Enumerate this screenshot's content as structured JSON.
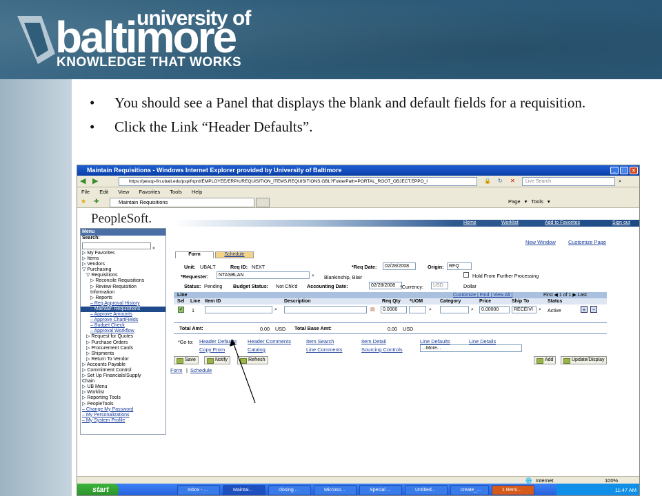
{
  "banner": {
    "university_of": "university of",
    "baltimore": "baltimore",
    "tagline": "KNOWLEDGE THAT WORKS"
  },
  "bullets": [
    "You should see a Panel that displays the blank and default fields for a requisition.",
    "Click the Link “Header Defaults”."
  ],
  "browser": {
    "title": "Maintain Requisitions - Windows Internet Explorer provided by University of Baltimore",
    "url": "https://pesop-fin.ubalt.edu/psp/fnprd/EMPLOYEE/ERP/c/REQUISITION_ITEMS.REQUISITIONS.GBL?FolderPath=PORTAL_ROOT_OBJECT.EPPO_I",
    "search_placeholder": "Live Search",
    "menu": [
      "File",
      "Edit",
      "View",
      "Favorites",
      "Tools",
      "Help"
    ],
    "tab": "Maintain Requisitions",
    "toolbar_right": "Page ▾  Tools ▾"
  },
  "ps": {
    "logo": "PeopleSoft.",
    "nav": [
      "Home",
      "Worklist",
      "Add to Favorites",
      "Sign out"
    ],
    "menu_title": "Menu",
    "search_label": "Search:",
    "menu_items": [
      {
        "t": "▷ My Favorites",
        "c": ""
      },
      {
        "t": "▷ Items",
        "c": ""
      },
      {
        "t": "▷ Vendors",
        "c": ""
      },
      {
        "t": "▽ Purchasing",
        "c": ""
      },
      {
        "t": "▽ Requisitions",
        "c": "i1"
      },
      {
        "t": "▷ Reconcile Requisitions",
        "c": "i2"
      },
      {
        "t": "▷ Review Requisition",
        "c": "i2"
      },
      {
        "t": "   Information",
        "c": "i2"
      },
      {
        "t": "▷ Reports",
        "c": "i2"
      },
      {
        "t": "– Req Approval History",
        "c": "i2 lnk"
      },
      {
        "t": "– Maintain Requisitions",
        "c": "i2 sel"
      },
      {
        "t": "– Approve Amounts",
        "c": "i2 lnk"
      },
      {
        "t": "– Approve ChartFields",
        "c": "i2 lnk"
      },
      {
        "t": "– Budget Check",
        "c": "i2 lnk"
      },
      {
        "t": "– Approval Workflow",
        "c": "i2 lnk"
      },
      {
        "t": "▷ Request for Quotes",
        "c": "i1"
      },
      {
        "t": "▷ Purchase Orders",
        "c": "i1"
      },
      {
        "t": "▷ Procurement Cards",
        "c": "i1"
      },
      {
        "t": "▷ Shipments",
        "c": "i1"
      },
      {
        "t": "▷ Return To Vendor",
        "c": "i1"
      },
      {
        "t": "▷ Accounts Payable",
        "c": ""
      },
      {
        "t": "▷ Commitment Control",
        "c": ""
      },
      {
        "t": "▷ Set Up Financials/Supply",
        "c": ""
      },
      {
        "t": "   Chain",
        "c": ""
      },
      {
        "t": "▷ UB Menu",
        "c": ""
      },
      {
        "t": "▷ Worklist",
        "c": ""
      },
      {
        "t": "▷ Reporting Tools",
        "c": ""
      },
      {
        "t": "▷ PeopleTools",
        "c": ""
      },
      {
        "t": "– Change My Password",
        "c": "lnk"
      },
      {
        "t": "– My Personalizations",
        "c": "lnk"
      },
      {
        "t": "– My System Profile",
        "c": "lnk"
      }
    ],
    "page_links": {
      "new_window": "New Window",
      "customize": "Customize Page"
    },
    "tabs": [
      "Form",
      "Schedule"
    ],
    "unit_label": "Unit:",
    "unit": "UBALT",
    "reqid_label": "Req ID:",
    "reqid": "NEXT",
    "reqdate_label": "*Req Date:",
    "reqdate": "02/28/2008",
    "origin_label": "Origin:",
    "origin": "RFQ",
    "requester_label": "*Requester:",
    "requester": "NTASBLAN",
    "requester_name": "Blankinship, Blair",
    "hold_label": "Hold From Further Processing",
    "status_label": "Status:",
    "status": "Pending",
    "budget_label": "Budget Status:",
    "budget": "Not Chk'd",
    "acctdate_label": "Accounting Date:",
    "acctdate": "02/28/2008",
    "currency_label": "*Currency:",
    "currency": "USD",
    "currency_desc": "Dollar",
    "line_title": "Line",
    "line_nav": "Customize | Find | View All |",
    "line_pager": "First ◀ 1 of 1 ▶ Last",
    "cols": [
      "Sel",
      "Line",
      "Item ID",
      "Description",
      "Req Qty",
      "*UOM",
      "Category",
      "Price",
      "Ship To",
      "Status"
    ],
    "row": {
      "line": "1",
      "qty": "0.0000",
      "price": "0.00000",
      "shipto": "RECEIVI",
      "status": "Active"
    },
    "total_amt_label": "Total Amt:",
    "total_amt": "0.00",
    "total_cur": "USD",
    "total_base_label": "Total Base Amt:",
    "total_base": "0.00",
    "total_base_cur": "USD",
    "goto_label": "*Go to:",
    "goto_links": [
      "Header Defaults",
      "Header Comments",
      "Item Search",
      "Item Detail",
      "Line Defaults",
      "Line Details",
      "Copy From",
      "Catalog",
      "Line Comments",
      "Sourcing Controls"
    ],
    "more": "...More...",
    "buttons": {
      "save": "Save",
      "notify": "Notify",
      "refresh": "Refresh",
      "add": "Add",
      "update": "Update/Display"
    },
    "footer_links": [
      "Form",
      "Schedule"
    ]
  },
  "status": {
    "zone": "Internet",
    "zoom": "100%"
  },
  "taskbar": {
    "start": "start",
    "items": [
      "Inbox - ...",
      "Maintai...",
      "closing ...",
      "Microso...",
      "Special ...",
      "Untitled...",
      "create_...",
      "1 Remi..."
    ],
    "time": "11:47 AM"
  }
}
